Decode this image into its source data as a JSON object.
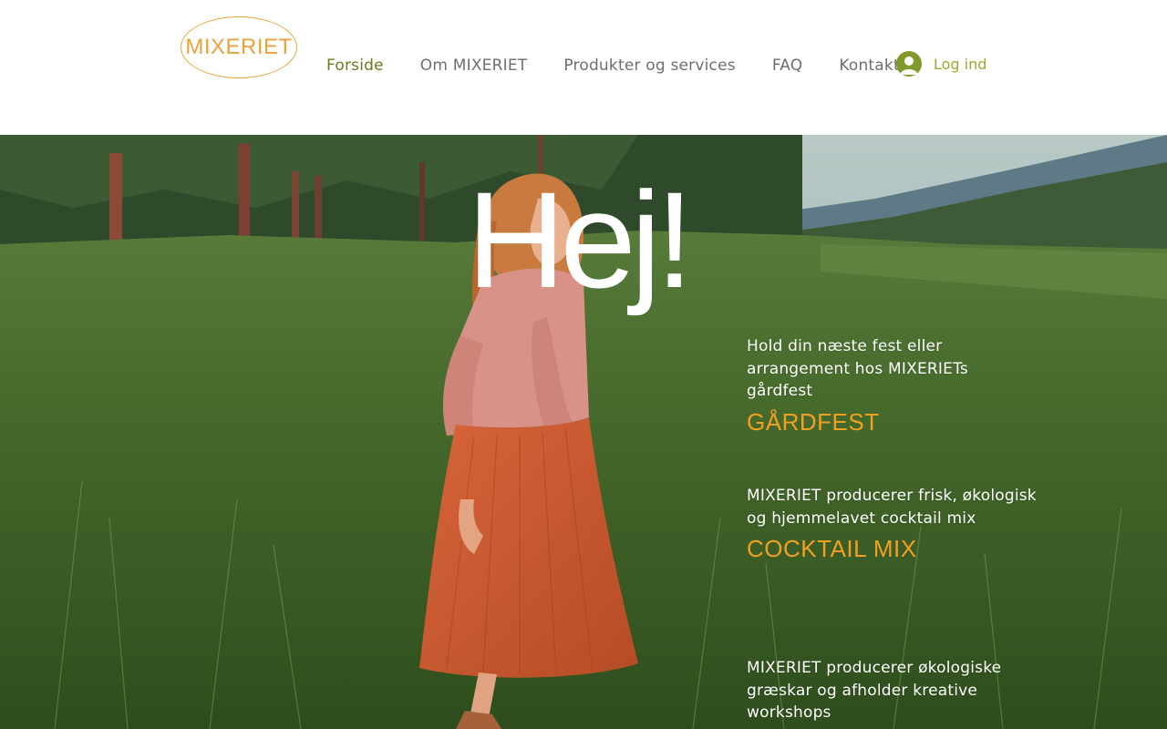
{
  "header": {
    "logo_text": "MIXERIET",
    "nav": [
      {
        "label": "Forside",
        "active": true
      },
      {
        "label": "Om MIXERIET"
      },
      {
        "label": "Produkter og services"
      },
      {
        "label": "FAQ"
      },
      {
        "label": "Kontakt"
      }
    ],
    "login_label": "Log ind"
  },
  "hero": {
    "title": "Hej!",
    "blocks": [
      {
        "text": "Hold din næste fest eller arrangement hos MIXERIETs gårdfest",
        "link": "GÅRDFEST"
      },
      {
        "text": "MIXERIET producerer frisk, økologisk og hjemmelavet cocktail mix",
        "link": "COCKTAIL MIX"
      },
      {
        "text": "MIXERIET producerer økologiske græskar og afholder kreative workshops",
        "link": ""
      }
    ]
  },
  "colors": {
    "brand_orange": "#e8a23a",
    "nav_active": "#6b7a1f",
    "login_green": "#9aaa28",
    "link_orange": "#f0a020"
  },
  "icons": {
    "login": "user-avatar-icon"
  }
}
